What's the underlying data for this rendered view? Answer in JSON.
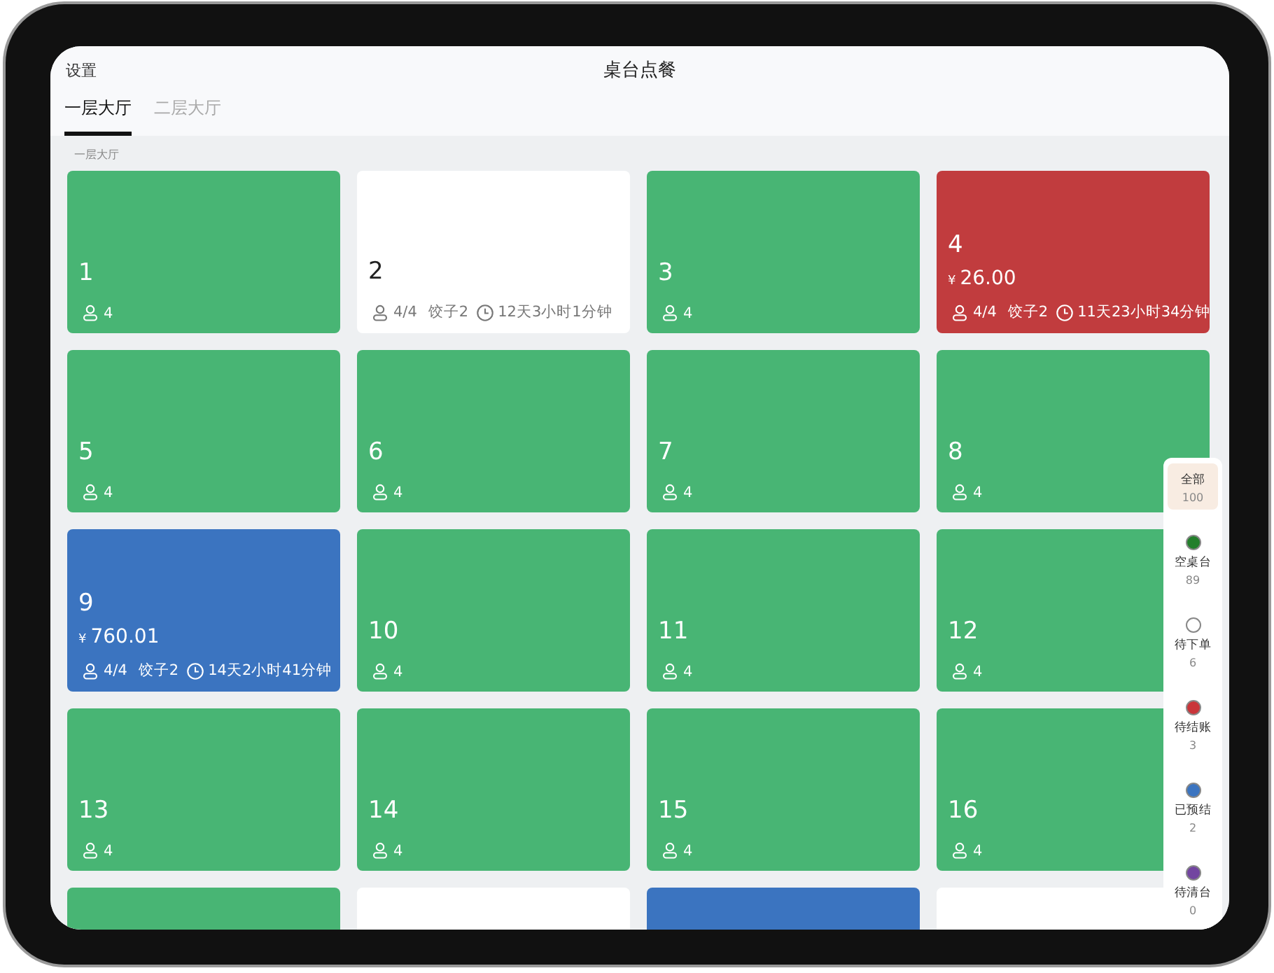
{
  "header": {
    "settings": "设置",
    "title": "桌台点餐"
  },
  "tabs": [
    {
      "label": "一层大厅",
      "selected": true
    },
    {
      "label": "二层大厅",
      "selected": false
    }
  ],
  "section_label": "一层大厅",
  "tables": [
    {
      "number": "1",
      "kind": "empty",
      "guests": "4"
    },
    {
      "number": "2",
      "kind": "ordering",
      "guests": "4/4",
      "dish": "饺子2",
      "duration": "12天3小时1分钟"
    },
    {
      "number": "3",
      "kind": "empty",
      "guests": "4"
    },
    {
      "number": "4",
      "kind": "checkout",
      "amount": "26.00",
      "guests": "4/4",
      "dish": "饺子2",
      "duration": "11天23小时34分钟"
    },
    {
      "number": "5",
      "kind": "empty",
      "guests": "4"
    },
    {
      "number": "6",
      "kind": "empty",
      "guests": "4"
    },
    {
      "number": "7",
      "kind": "empty",
      "guests": "4"
    },
    {
      "number": "8",
      "kind": "empty",
      "guests": "4"
    },
    {
      "number": "9",
      "kind": "prepaid",
      "amount": "760.01",
      "guests": "4/4",
      "dish": "饺子2",
      "duration": "14天2小时41分钟"
    },
    {
      "number": "10",
      "kind": "empty",
      "guests": "4"
    },
    {
      "number": "11",
      "kind": "empty",
      "guests": "4"
    },
    {
      "number": "12",
      "kind": "empty",
      "guests": "4"
    },
    {
      "number": "13",
      "kind": "empty",
      "guests": "4"
    },
    {
      "number": "14",
      "kind": "empty",
      "guests": "4"
    },
    {
      "number": "15",
      "kind": "empty",
      "guests": "4"
    },
    {
      "number": "16",
      "kind": "empty",
      "guests": "4"
    },
    {
      "kind": "empty"
    },
    {
      "kind": "ordering"
    },
    {
      "kind": "prepaid"
    },
    {
      "kind": "ordering"
    }
  ],
  "currency": "¥",
  "legend": [
    {
      "label": "全部",
      "count": "100",
      "selected": true
    },
    {
      "label": "空桌台",
      "count": "89",
      "color": "#237f2c",
      "selected": false
    },
    {
      "label": "待下单",
      "count": "6",
      "color": "#ffffff",
      "selected": false
    },
    {
      "label": "待结账",
      "count": "3",
      "color": "#c9353a",
      "selected": false
    },
    {
      "label": "已预结",
      "count": "2",
      "color": "#3b74c0",
      "selected": false
    },
    {
      "label": "待清台",
      "count": "0",
      "color": "#7245a0",
      "selected": false
    }
  ]
}
